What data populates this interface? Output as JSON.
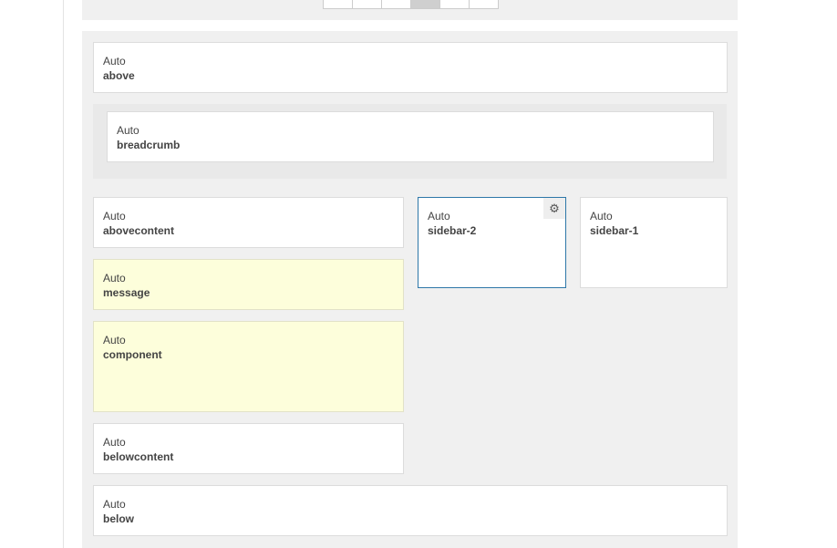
{
  "pager": {
    "pages": 6,
    "active_index": 3
  },
  "positions": {
    "above": {
      "mode": "Auto",
      "name": "above"
    },
    "breadcrumb": {
      "mode": "Auto",
      "name": "breadcrumb"
    },
    "abovecontent": {
      "mode": "Auto",
      "name": "abovecontent"
    },
    "message": {
      "mode": "Auto",
      "name": "message"
    },
    "component": {
      "mode": "Auto",
      "name": "component"
    },
    "belowcontent": {
      "mode": "Auto",
      "name": "belowcontent"
    },
    "sidebar_2": {
      "mode": "Auto",
      "name": "sidebar-2"
    },
    "sidebar_1": {
      "mode": "Auto",
      "name": "sidebar-1"
    },
    "below": {
      "mode": "Auto",
      "name": "below"
    }
  },
  "icons": {
    "settings": "gear-icon"
  },
  "colors": {
    "highlight": "#fdfedb",
    "selected_border": "#2d77a8",
    "panel_bg": "#f0f0f0"
  }
}
